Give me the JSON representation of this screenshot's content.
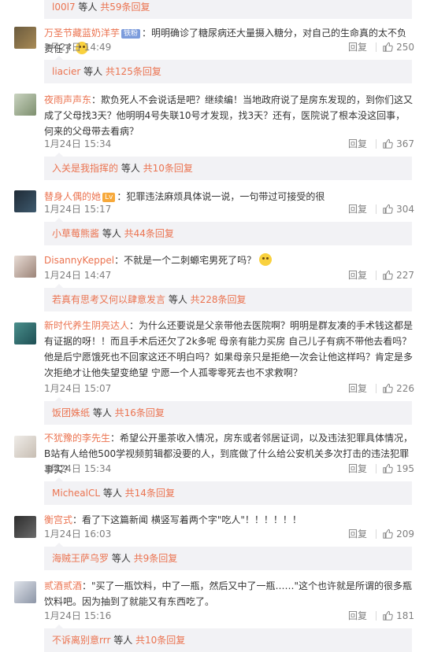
{
  "like_label": "回复",
  "comments": [
    {
      "user": "万圣节藏蓝奶洋芋",
      "badge": "铁粉",
      "text": "：明明确诊了糖尿病还大量摄入糖分，对自己的生命真的太不负责任了",
      "date": "1月24日 14:49",
      "reply": "回复",
      "likes": "250",
      "sub_user": "liacier",
      "sub_text": " 等人 ",
      "sub_count": "共125条回复"
    },
    {
      "user": "夜雨声声东",
      "text": "：欺负死人不会说话是吧？继续编！当地政府说了是房东发现的，到你们这又成了父母找3天？他明明4号失联10号才发现，找3天？还有，医院说了根本没这回事，何来的父母带去看病？",
      "date": "1月24日 15:34",
      "reply": "回复",
      "likes": "367",
      "sub_user": "入关是我指挥的",
      "sub_text": " 等人 ",
      "sub_count": "共10条回复"
    },
    {
      "user": "替身人偶的她",
      "badge": "Lv",
      "text": "：犯罪违法麻烦具体说一说，一句带过可接受的很",
      "date": "1月24日 15:17",
      "reply": "回复",
      "likes": "304",
      "sub_user": "小草莓熊酱",
      "sub_text": " 等人 ",
      "sub_count": "共44条回复"
    },
    {
      "user": "DisannyKeppel",
      "text": "：不就是一个二刺螈宅男死了吗？",
      "date": "1月24日 14:47",
      "reply": "回复",
      "likes": "227",
      "sub_user": "若真有思考又何以肆意发言",
      "sub_text": " 等人 ",
      "sub_count": "共228条回复"
    },
    {
      "user": "新时代养生阴亮达人",
      "text": "：为什么还要说是父亲带他去医院啊？明明是群友凑的手术钱这都是有证据的呀！！而且手术后还欠了2k多呢 母亲有能力买房 自己儿子有病不带他去看吗？他是后宁愿饿死也不回家这还不明白吗？如果母亲只是拒绝一次会让他这样吗？肯定是多次拒绝才让他失望变绝望 宁愿一个人孤零零死去也不求救啊？",
      "date": "1月24日 15:07",
      "reply": "回复",
      "likes": "226",
      "sub_user": "饭团姝纸",
      "sub_text": " 等人 ",
      "sub_count": "共16条回复"
    },
    {
      "user": "不犹豫的李先生",
      "text": "：希望公开墨茶收入情况，房东或者邻居证词，以及违法犯罪具体情况，B站有人给他500学视频剪辑都没要的人，到底做了什么给公安机关多次打击的违法犯罪事实？",
      "date": "1月24日 15:34",
      "reply": "回复",
      "likes": "195",
      "sub_user": "MichealCL",
      "sub_text": " 等人 ",
      "sub_count": "共14条回复"
    },
    {
      "user": "衡宫式",
      "text": "：看了下这篇新闻 横竖写着两个字\"吃人\"！！！！！！",
      "date": "1月24日 16:03",
      "reply": "回复",
      "likes": "209",
      "sub_user": "海贼王萨乌罗",
      "sub_text": " 等人 ",
      "sub_count": "共9条回复"
    },
    {
      "user": "贰酒贰酒",
      "text": "：\"买了一瓶饮料，中了一瓶，然后又中了一瓶……\"这个也许就是所谓的很多瓶饮料吧。因为抽到了就能又有东西吃了。",
      "date": "1月24日 15:16",
      "reply": "回复",
      "likes": "181",
      "sub_user": "不诉离别意rrr",
      "sub_text": " 等人 ",
      "sub_count": "共10条回复"
    }
  ],
  "top_sub": {
    "sub_user": "l00l7",
    "sub_text": " 等人 ",
    "sub_count": "共59条回复"
  },
  "colors": {
    "username": "#eb7350",
    "meta": "#808080",
    "sub_bg": "#f2f2f5"
  },
  "icons": [
    "thumbs-up-icon",
    "avatar"
  ]
}
